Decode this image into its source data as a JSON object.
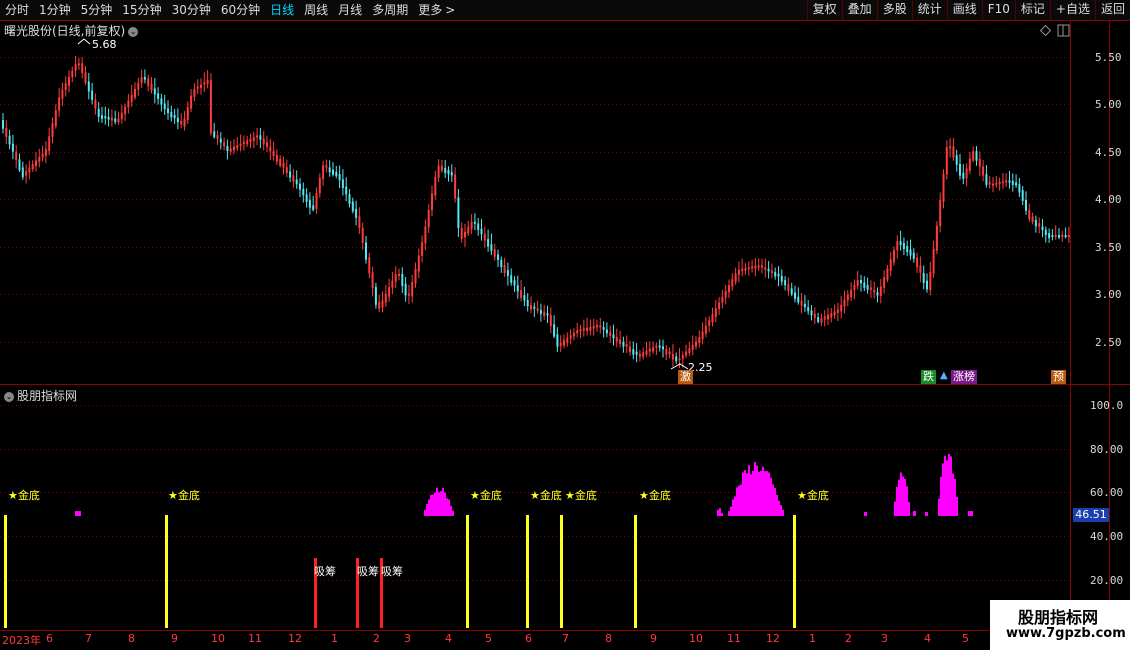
{
  "toolbar": {
    "periods": [
      "分时",
      "1分钟",
      "5分钟",
      "15分钟",
      "30分钟",
      "60分钟",
      "日线",
      "周线",
      "月线",
      "多周期",
      "更多"
    ],
    "active_period": "日线",
    "right_buttons": [
      "复权",
      "叠加",
      "多股",
      "统计",
      "画线",
      "F10",
      "标记",
      "+自选",
      "返回"
    ]
  },
  "price_panel": {
    "title": "曙光股份(日线,前复权)",
    "high_label": "5.68",
    "low_label": "2.25",
    "y_ticks": [
      "5.50",
      "5.00",
      "4.50",
      "4.00",
      "3.50",
      "3.00",
      "2.50"
    ],
    "badges": {
      "ji": "激",
      "die": "跌",
      "zhangbang": "涨榜",
      "yu": "预"
    }
  },
  "indicator_panel": {
    "title": "股朋指标网",
    "y_ticks": [
      "100.0",
      "80.00",
      "60.00",
      "40.00",
      "20.00"
    ],
    "current_value": "46.51",
    "gold_label": "★金底",
    "absorb_label": "吸筹"
  },
  "x_axis": {
    "labels": [
      "2023年",
      "6",
      "7",
      "8",
      "9",
      "10",
      "11",
      "12",
      "1",
      "2",
      "3",
      "4",
      "5",
      "6",
      "7",
      "8",
      "9",
      "10",
      "11",
      "12",
      "1",
      "2",
      "3",
      "4",
      "5"
    ]
  },
  "watermark": {
    "line1": "股朋指标网",
    "line2": "www.7gpzb.com"
  },
  "colors": {
    "up": "#ff3b3b",
    "down": "#54e8f0",
    "gold": "#ffff20",
    "magenta": "#ff00ff",
    "frame": "#8b0000"
  }
}
